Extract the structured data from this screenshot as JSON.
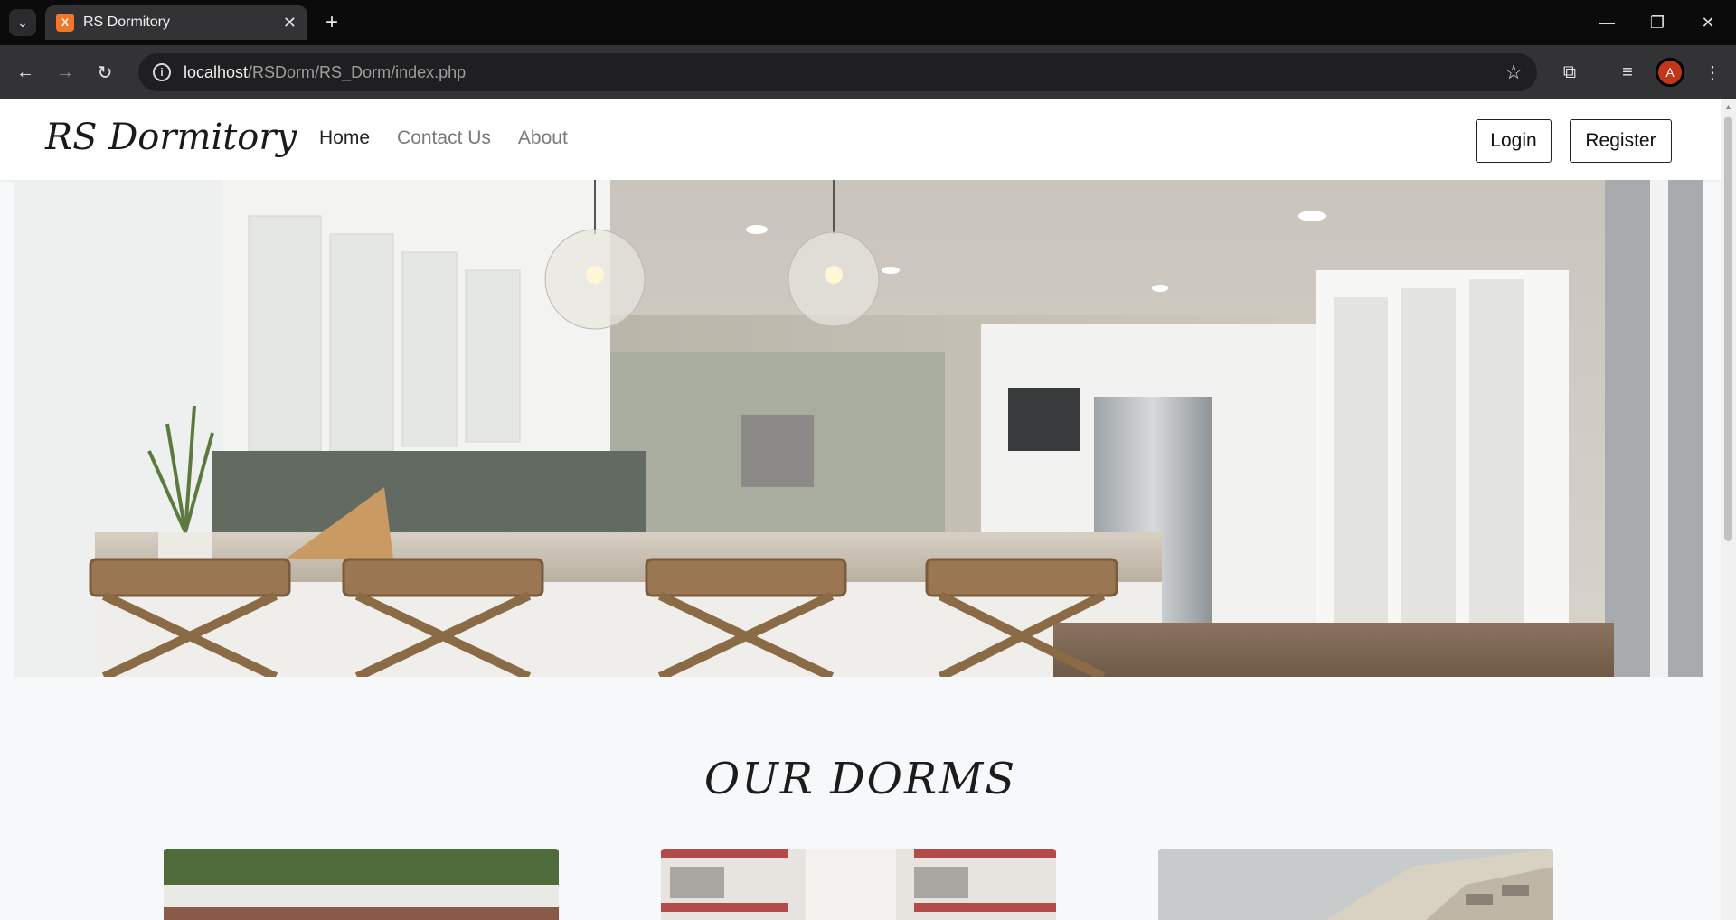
{
  "browser": {
    "tab_title": "RS Dormitory",
    "favicon_text": "X",
    "url_host": "localhost",
    "url_path": "/RSDorm/RS_Dorm/index.php",
    "profile_initial": "A"
  },
  "site": {
    "brand": "RS Dormitory",
    "nav": [
      "Home",
      "Contact Us",
      "About"
    ],
    "login_label": "Login",
    "register_label": "Register",
    "section_title": "OUR DORMS"
  },
  "colors": {
    "accent": "#f0782a",
    "page_bg": "#f7f8fa"
  }
}
